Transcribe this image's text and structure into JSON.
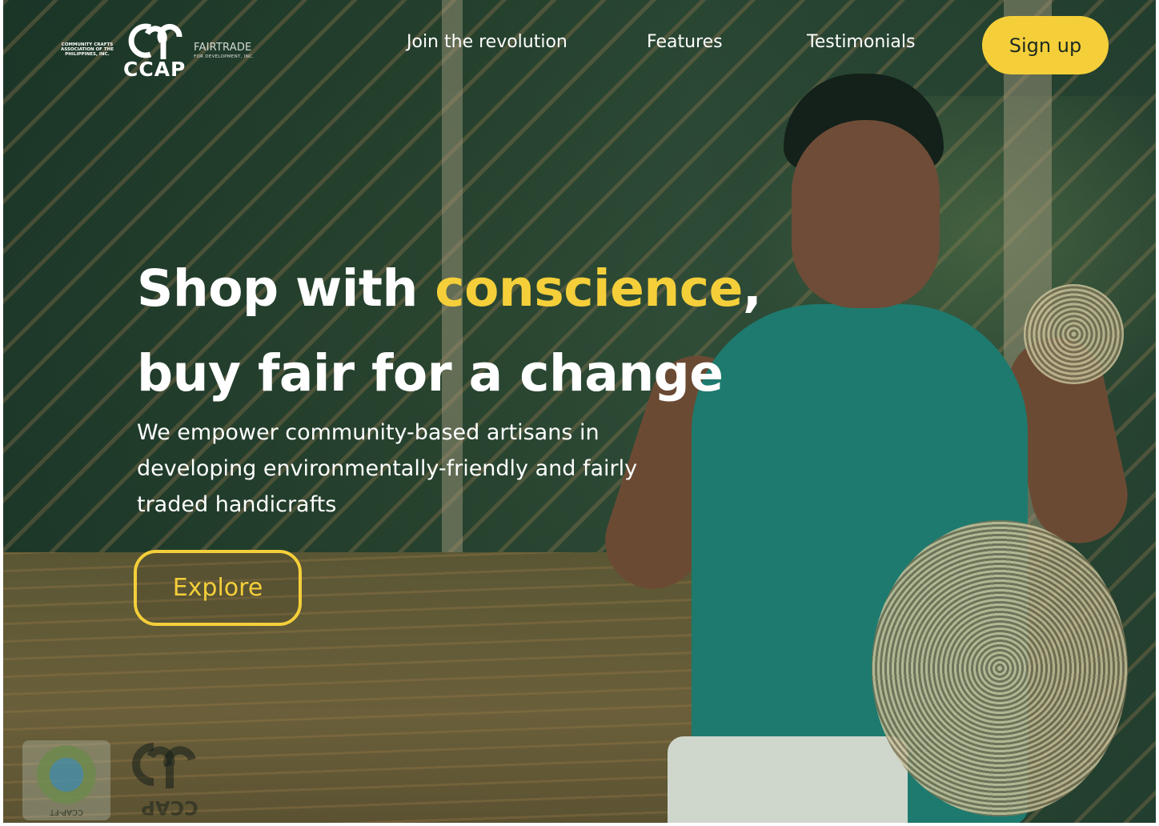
{
  "logo": {
    "org_line": "COMMUNITY CRAFTS ASSOCIATION OF THE PHILIPPINES, INC.",
    "wordmark": "CCAP",
    "fairtrade": "FAIRTRADE",
    "fairtrade_sub": "FOR DEVELOPMENT, INC."
  },
  "nav": {
    "items": [
      "Join the revolution",
      "Features",
      "Testimonials"
    ],
    "signup_label": "Sign up"
  },
  "hero": {
    "headline_part1": "Shop with ",
    "headline_accent": "conscience",
    "headline_comma": ",",
    "headline_line2": "buy fair for a change",
    "subtext": "We empower community-based artisans in developing environmentally-friendly and fairly traded handicrafts",
    "cta_label": "Explore"
  },
  "badges": {
    "wfto_code": "CCAP-FT"
  },
  "colors": {
    "accent": "#f5cf3a",
    "overlay": "#2b4630",
    "text": "#ffffff"
  }
}
